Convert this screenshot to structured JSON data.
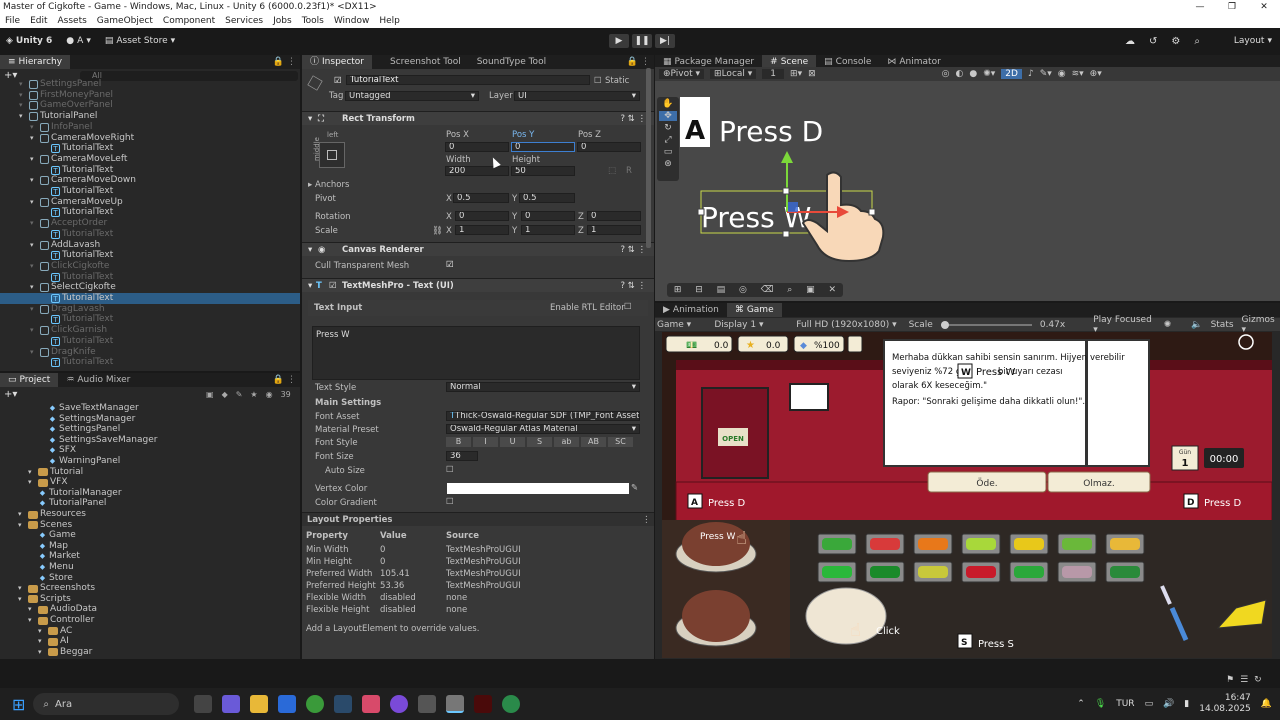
{
  "window": {
    "title": "Master of Cigkofte - Game - Windows, Mac, Linux - Unity 6 (6000.0.23f1)* <DX11>",
    "min": "—",
    "max": "❐",
    "close": "✕"
  },
  "menu": [
    "File",
    "Edit",
    "Assets",
    "GameObject",
    "Component",
    "Services",
    "Jobs",
    "Tools",
    "Window",
    "Help"
  ],
  "toolbar": {
    "unity": "Unity 6",
    "account": "A",
    "store": "Asset Store",
    "layout": "Layout"
  },
  "hierarchy": {
    "tab": "Hierarchy",
    "search_placeholder": "All",
    "rows": [
      {
        "t": "SettingsPanel",
        "d": 1,
        "dim": true,
        "ic": "go"
      },
      {
        "t": "FirstMoneyPanel",
        "d": 1,
        "dim": true,
        "ic": "go"
      },
      {
        "t": "GameOverPanel",
        "d": 1,
        "dim": true,
        "ic": "go"
      },
      {
        "t": "TutorialPanel",
        "d": 1,
        "dim": false,
        "ic": "go"
      },
      {
        "t": "InfoPanel",
        "d": 2,
        "dim": true,
        "ic": "go"
      },
      {
        "t": "CameraMoveRight",
        "d": 2,
        "dim": false,
        "ic": "go"
      },
      {
        "t": "TutorialText",
        "d": 3,
        "dim": false,
        "ic": "t"
      },
      {
        "t": "CameraMoveLeft",
        "d": 2,
        "dim": false,
        "ic": "go"
      },
      {
        "t": "TutorialText",
        "d": 3,
        "dim": false,
        "ic": "t"
      },
      {
        "t": "CameraMoveDown",
        "d": 2,
        "dim": false,
        "ic": "go"
      },
      {
        "t": "TutorialText",
        "d": 3,
        "dim": false,
        "ic": "t"
      },
      {
        "t": "CameraMoveUp",
        "d": 2,
        "dim": false,
        "ic": "go"
      },
      {
        "t": "TutorialText",
        "d": 3,
        "dim": false,
        "ic": "t"
      },
      {
        "t": "AcceptOrder",
        "d": 2,
        "dim": true,
        "ic": "go"
      },
      {
        "t": "TutorialText",
        "d": 3,
        "dim": true,
        "ic": "t"
      },
      {
        "t": "AddLavash",
        "d": 2,
        "dim": false,
        "ic": "go"
      },
      {
        "t": "TutorialText",
        "d": 3,
        "dim": false,
        "ic": "t"
      },
      {
        "t": "ClickCigkofte",
        "d": 2,
        "dim": true,
        "ic": "go"
      },
      {
        "t": "TutorialText",
        "d": 3,
        "dim": true,
        "ic": "t"
      },
      {
        "t": "SelectCigkofte",
        "d": 2,
        "dim": false,
        "ic": "go"
      },
      {
        "t": "TutorialText",
        "d": 3,
        "dim": false,
        "ic": "t",
        "sel": true
      },
      {
        "t": "DragLavash",
        "d": 2,
        "dim": true,
        "ic": "go"
      },
      {
        "t": "TutorialText",
        "d": 3,
        "dim": true,
        "ic": "t"
      },
      {
        "t": "ClickGarnish",
        "d": 2,
        "dim": true,
        "ic": "go"
      },
      {
        "t": "TutorialText",
        "d": 3,
        "dim": true,
        "ic": "t"
      },
      {
        "t": "DragKnife",
        "d": 2,
        "dim": true,
        "ic": "go"
      },
      {
        "t": "TutorialText",
        "d": 3,
        "dim": true,
        "ic": "t"
      }
    ]
  },
  "project": {
    "tab": "Project",
    "tab2": "Audio Mixer",
    "count": "39",
    "rows": [
      {
        "t": "SaveTextManager",
        "d": 3,
        "ic": "s"
      },
      {
        "t": "SettingsManager",
        "d": 3,
        "ic": "s"
      },
      {
        "t": "SettingsPanel",
        "d": 3,
        "ic": "s"
      },
      {
        "t": "SettingsSaveManager",
        "d": 3,
        "ic": "s"
      },
      {
        "t": "SFX",
        "d": 3,
        "ic": "s"
      },
      {
        "t": "WarningPanel",
        "d": 3,
        "ic": "s"
      },
      {
        "t": "Tutorial",
        "d": 2,
        "ic": "f"
      },
      {
        "t": "VFX",
        "d": 2,
        "ic": "f"
      },
      {
        "t": "TutorialManager",
        "d": 2,
        "ic": "s"
      },
      {
        "t": "TutorialPanel",
        "d": 2,
        "ic": "s"
      },
      {
        "t": "Resources",
        "d": 1,
        "ic": "f"
      },
      {
        "t": "Scenes",
        "d": 1,
        "ic": "f"
      },
      {
        "t": "Game",
        "d": 2,
        "ic": "s"
      },
      {
        "t": "Map",
        "d": 2,
        "ic": "s"
      },
      {
        "t": "Market",
        "d": 2,
        "ic": "s"
      },
      {
        "t": "Menu",
        "d": 2,
        "ic": "s"
      },
      {
        "t": "Store",
        "d": 2,
        "ic": "s"
      },
      {
        "t": "Screenshots",
        "d": 1,
        "ic": "f"
      },
      {
        "t": "Scripts",
        "d": 1,
        "ic": "f"
      },
      {
        "t": "AudioData",
        "d": 2,
        "ic": "f"
      },
      {
        "t": "Controller",
        "d": 2,
        "ic": "f"
      },
      {
        "t": "AC",
        "d": 3,
        "ic": "f"
      },
      {
        "t": "AI",
        "d": 3,
        "ic": "f"
      },
      {
        "t": "Beggar",
        "d": 3,
        "ic": "f"
      }
    ]
  },
  "inspector": {
    "tabs": [
      "Inspector",
      "Screenshot Tool",
      "SoundType Tool"
    ],
    "name": "TutorialText",
    "static": "Static",
    "tag_label": "Tag",
    "tag": "Untagged",
    "layer_label": "Layer",
    "layer": "UI",
    "rect": {
      "title": "Rect Transform",
      "anchor_left": "left",
      "anchor_mid": "middle",
      "posx_l": "Pos X",
      "posy_l": "Pos Y",
      "posz_l": "Pos Z",
      "posx": "0",
      "posy": "0",
      "posz": "0",
      "w_l": "Width",
      "h_l": "Height",
      "w": "200",
      "h": "50",
      "r": "R",
      "anchors": "Anchors",
      "pivot": "Pivot",
      "pivot_x": "0.5",
      "pivot_y": "0.5",
      "rotation": "Rotation",
      "rot_x": "0",
      "rot_y": "0",
      "rot_z": "0",
      "scale": "Scale",
      "sx": "1",
      "sy": "1",
      "sz": "1",
      "xl": "X",
      "yl": "Y",
      "zl": "Z"
    },
    "canvas": {
      "title": "Canvas Renderer",
      "cull": "Cull Transparent Mesh"
    },
    "tmp": {
      "title": "TextMeshPro - Text (UI)",
      "text_input": "Text Input",
      "rtl": "Enable RTL Editor",
      "text": "Press W",
      "style_l": "Text Style",
      "style": "Normal",
      "main": "Main Settings",
      "font_asset_l": "Font Asset",
      "font_asset": "Thick-Oswald-Regular SDF (TMP_Font Asset)",
      "mat_l": "Material Preset",
      "mat": "Oswald-Regular Atlas Material",
      "fstyle_l": "Font Style",
      "fstyles": [
        "B",
        "I",
        "U",
        "S",
        "ab",
        "AB",
        "SC"
      ],
      "fsize_l": "Font Size",
      "fsize": "36",
      "autosize": "Auto Size",
      "vcolor": "Vertex Color",
      "cgrad": "Color Gradient"
    },
    "layout": {
      "title": "Layout Properties",
      "headers": [
        "Property",
        "Value",
        "Source"
      ],
      "rows": [
        [
          "Min Width",
          "0",
          "TextMeshProUGUI"
        ],
        [
          "Min Height",
          "0",
          "TextMeshProUGUI"
        ],
        [
          "Preferred Width",
          "105.41",
          "TextMeshProUGUI"
        ],
        [
          "Preferred Height",
          "53.36",
          "TextMeshProUGUI"
        ],
        [
          "Flexible Width",
          "disabled",
          "none"
        ],
        [
          "Flexible Height",
          "disabled",
          "none"
        ]
      ],
      "hint": "Add a LayoutElement to override values."
    }
  },
  "scene": {
    "tabs": [
      "Package Manager",
      "Scene",
      "Console",
      "Animator"
    ],
    "pivot": "Pivot",
    "local": "Local",
    "snap": "1",
    "mode2d": "2D",
    "press_d": "Press D",
    "press_w": "Press W",
    "key_a": "A"
  },
  "game": {
    "tabs": [
      "Animation",
      "Game"
    ],
    "display_mode": "Game",
    "display": "Display 1",
    "res": "Full HD (1920x1080)",
    "scale_l": "Scale",
    "scale": "0.47x",
    "play_focused": "Play Focused",
    "stats": "Stats",
    "gizmos": "Gizmos",
    "hud": {
      "money": "0.0",
      "stars": "0.0",
      "pct": "%100"
    },
    "dialog": {
      "line1": "Merhaba dükkan sahibi sensin sanırım. Hijyen",
      "line2": "seviyeniz %72 gö",
      "line2b": "bir uyarı cezası",
      "line3": "olarak 6X keseceğim.\"",
      "line4": "Rapor: \"Sonraki gelişime daha dikkatli olun!\".",
      "side": "verebilir",
      "pay": "Öde.",
      "no": "Olmaz."
    },
    "open_sign": "OPEN",
    "day_l": "Gün",
    "day": "1",
    "time": "00:00",
    "press_d": "Press D",
    "press_w": "Press W",
    "press_s": "Press S",
    "click": "Click",
    "key_a": "A",
    "key_d": "D",
    "key_w": "W",
    "key_s": "S"
  },
  "taskbar": {
    "search": "Ara",
    "lang": "TUR",
    "time": "16:47",
    "date": "14.08.2025"
  }
}
